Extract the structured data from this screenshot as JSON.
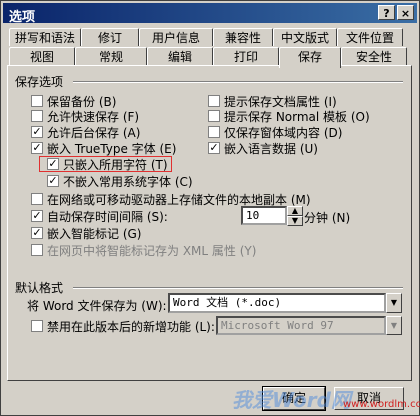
{
  "window": {
    "title": "选项",
    "help_glyph": "?",
    "close_glyph": "×"
  },
  "tabs_row1": [
    "拼写和语法",
    "修订",
    "用户信息",
    "兼容性",
    "中文版式",
    "文件位置"
  ],
  "tabs_row2": [
    "视图",
    "常规",
    "编辑",
    "打印",
    "保存",
    "安全性"
  ],
  "active_tab": "保存",
  "save_options": {
    "group_title": "保存选项",
    "left": [
      {
        "label": "保留备份 (B)",
        "checked": false
      },
      {
        "label": "允许快速保存 (F)",
        "checked": false
      },
      {
        "label": "允许后台保存 (A)",
        "checked": true
      },
      {
        "label": "嵌入 TrueType 字体 (E)",
        "checked": true
      },
      {
        "label": "只嵌入所用字符 (T)",
        "checked": true
      },
      {
        "label": "不嵌入常用系统字体 (C)",
        "checked": true
      }
    ],
    "right": [
      {
        "label": "提示保存文档属性 (I)",
        "checked": false
      },
      {
        "label": "提示保存 Normal 模板 (O)",
        "checked": false
      },
      {
        "label": "仅保存窗体域内容 (D)",
        "checked": false
      },
      {
        "label": "嵌入语言数据 (U)",
        "checked": true
      }
    ],
    "network_copy": {
      "label": "在网络或可移动驱动器上存储文件的本地副本 (M)",
      "checked": false
    },
    "autosave": {
      "label": "自动保存时间间隔 (S):",
      "checked": true,
      "value": "10",
      "unit": "分钟 (N)"
    },
    "smart_tags": {
      "label": "嵌入智能标记 (G)",
      "checked": true
    },
    "web_xml": {
      "label": "在网页中将智能标记存为 XML 属性 (Y)",
      "checked": false
    }
  },
  "default_format": {
    "group_title": "默认格式",
    "save_as_label": "将 Word 文件保存为 (W):",
    "save_as_value": "Word 文档 (*.doc)",
    "disable_label": "禁用在此版本后的新增功能 (L):",
    "disable_value": "Microsoft Word 97",
    "disable_checked": false
  },
  "buttons": {
    "ok": "确定",
    "cancel": "取消"
  },
  "watermark": {
    "text": "我爱Word网",
    "url": "www.wordlm.com"
  },
  "colors": {
    "titlebar": "#0a246a",
    "face": "#d4d0c8",
    "highlight": "#e03030"
  }
}
